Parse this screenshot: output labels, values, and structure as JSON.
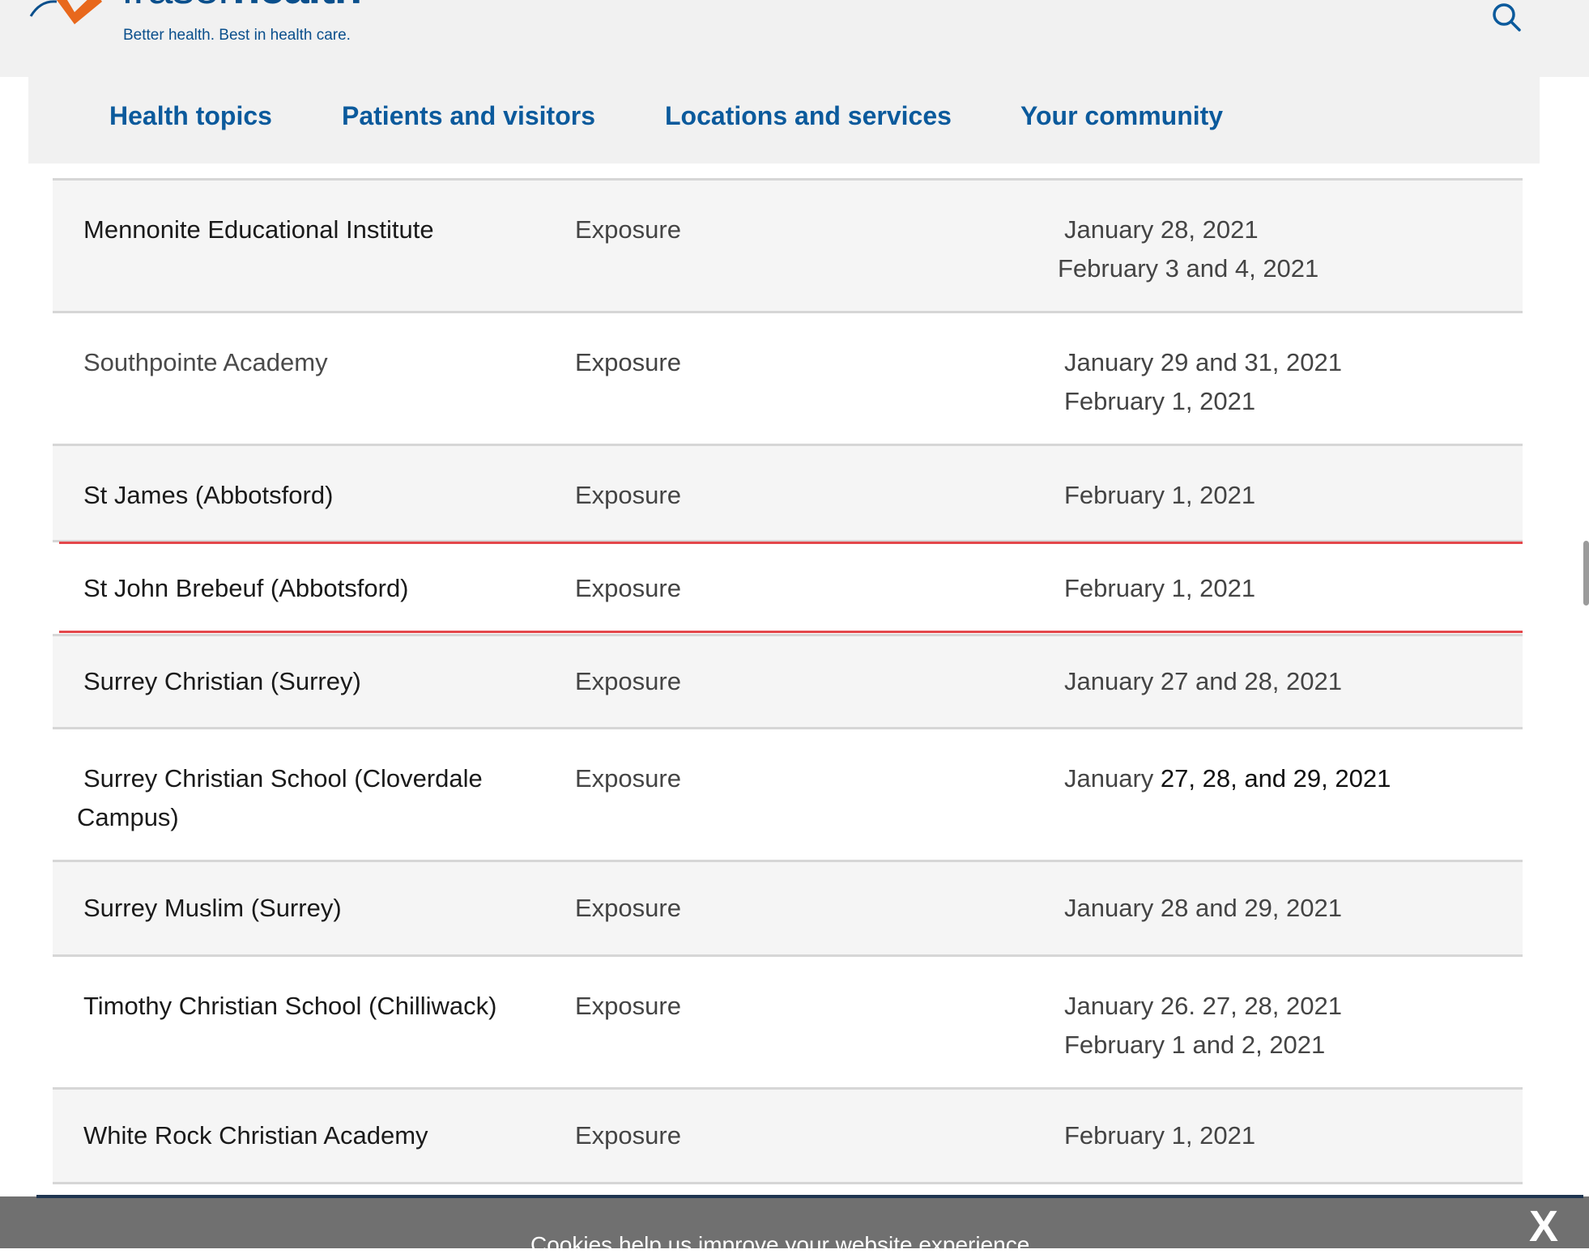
{
  "header": {
    "logo_word_light": "fraser",
    "logo_word_bold": "health",
    "tagline": "Better health. Best in health care.",
    "search_icon": "search-icon"
  },
  "nav": {
    "items": [
      {
        "label": "Health topics"
      },
      {
        "label": "Patients and visitors"
      },
      {
        "label": "Locations and services"
      },
      {
        "label": "Your community"
      }
    ]
  },
  "table": {
    "rows": [
      {
        "school": "Mennonite Educational Institute",
        "type": "Exposure",
        "dates_line1": "January 28, 2021",
        "dates_line2": "February 3 and 4, 2021"
      },
      {
        "school": "Southpointe Academy",
        "type": "Exposure",
        "dates_line1": "January 29 and 31, 2021",
        "dates_line2": "February 1, 2021"
      },
      {
        "school": "St James (Abbotsford)",
        "type": "Exposure",
        "dates_line1": "February 1, 2021"
      },
      {
        "school": "St John Brebeuf (Abbotsford)",
        "type": "Exposure",
        "dates_line1": "February 1, 2021"
      },
      {
        "school": "Surrey Christian (Surrey)",
        "type": "Exposure",
        "dates_line1": "January 27 and 28, 2021"
      },
      {
        "school_line1": "Surrey Christian School (Cloverdale",
        "school_line2": "Campus)",
        "type": "Exposure",
        "dates_prefix": "January",
        "dates_rest": " 27, 28, and 29, 2021"
      },
      {
        "school": "Surrey Muslim (Surrey)",
        "type": "Exposure",
        "dates_line1": "January 28 and 29,  2021"
      },
      {
        "school": "Timothy Christian School (Chilliwack)",
        "type": "Exposure",
        "dates_line1": "January 26. 27, 28, 2021",
        "dates_line2": "February 1 and 2, 2021"
      },
      {
        "school": "White Rock Christian Academy",
        "type": "Exposure",
        "dates_line1": "February 1, 2021"
      }
    ]
  },
  "cookie_banner": {
    "text": "Cookies help us improve your website experience.",
    "close_label": "X"
  },
  "colors": {
    "brand_blue": "#0b5a9c",
    "brand_orange": "#e8681c",
    "highlight_red": "#e4474b"
  }
}
